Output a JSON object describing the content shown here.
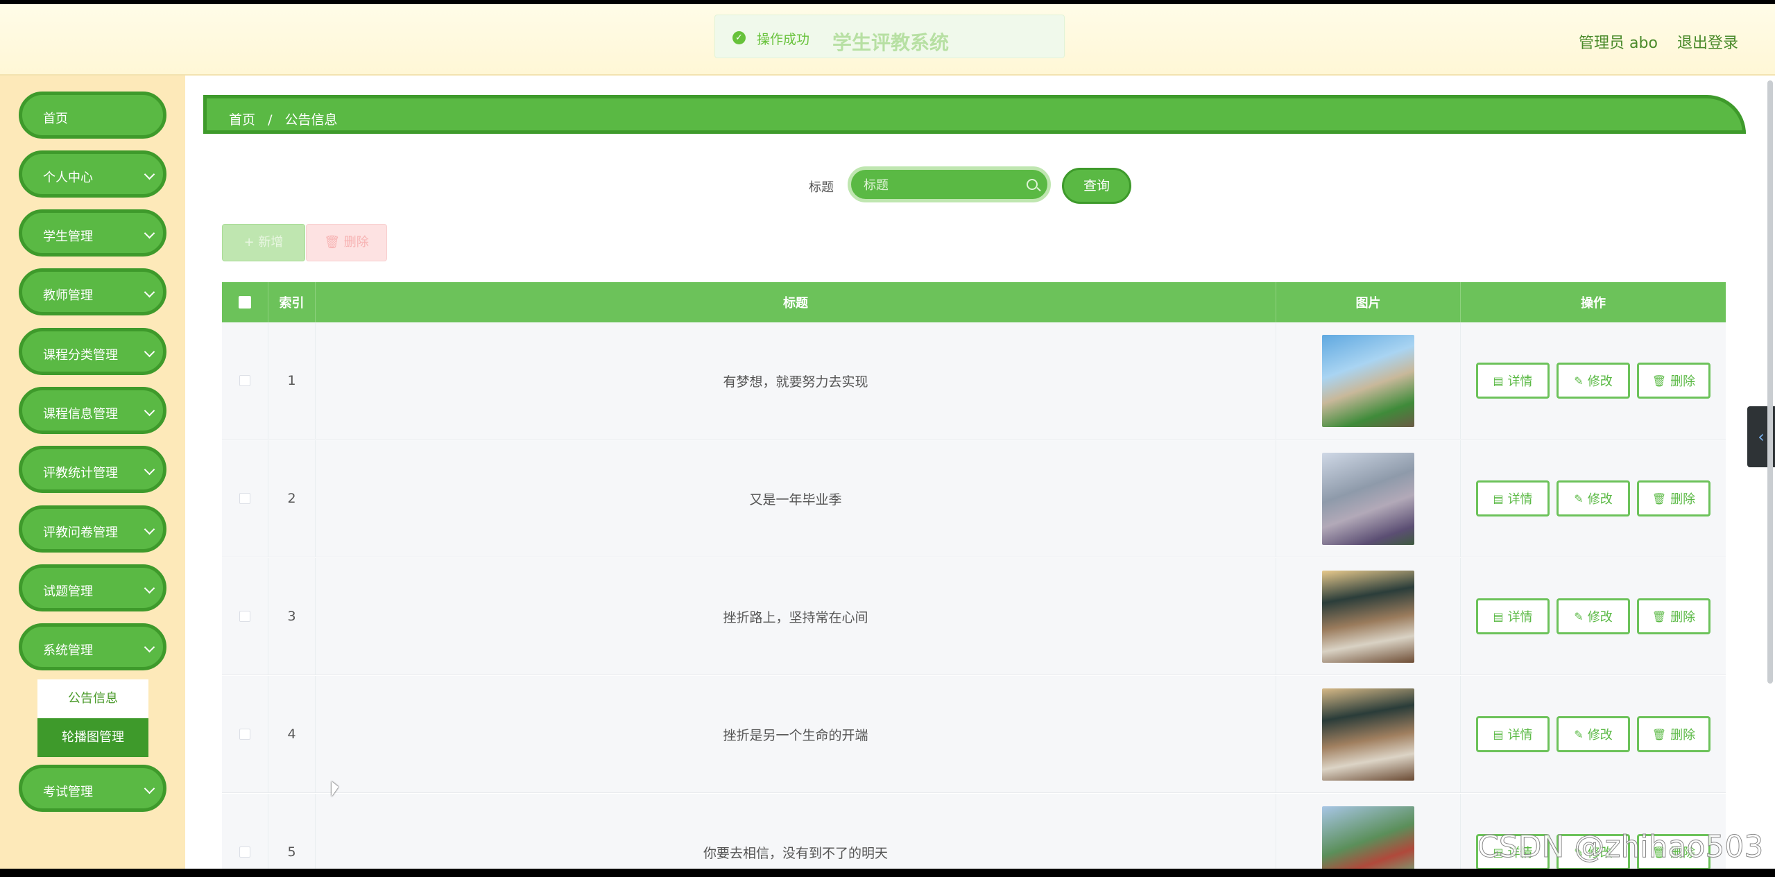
{
  "header": {
    "toast_message": "操作成功",
    "system_title": "学生评教系统",
    "user_label": "管理员 abo",
    "logout_label": "退出登录"
  },
  "sidebar": {
    "items": [
      {
        "label": "首页"
      },
      {
        "label": "个人中心"
      },
      {
        "label": "学生管理"
      },
      {
        "label": "教师管理"
      },
      {
        "label": "课程分类管理"
      },
      {
        "label": "课程信息管理"
      },
      {
        "label": "评教统计管理"
      },
      {
        "label": "评教问卷管理"
      },
      {
        "label": "试题管理"
      },
      {
        "label": "系统管理"
      },
      {
        "label": "考试管理"
      }
    ],
    "submenu": [
      "公告信息",
      "轮播图管理"
    ]
  },
  "breadcrumb": {
    "home": "首页",
    "separator": "/",
    "current": "公告信息"
  },
  "search": {
    "label": "标题",
    "placeholder": "标题",
    "query_label": "查询"
  },
  "toolbar": {
    "add_label": "+ 新增",
    "delete_label": "删除"
  },
  "table": {
    "headers": [
      "索引",
      "标题",
      "图片",
      "操作"
    ],
    "rows": [
      {
        "index": "1",
        "title": "有梦想，就要努力去实现"
      },
      {
        "index": "2",
        "title": "又是一年毕业季"
      },
      {
        "index": "3",
        "title": "挫折路上，坚持常在心间"
      },
      {
        "index": "4",
        "title": "挫折是另一个生命的开端"
      },
      {
        "index": "5",
        "title": "你要去相信，没有到不了的明天"
      }
    ],
    "actions": {
      "detail": "详情",
      "edit": "修改",
      "delete": "删除"
    }
  },
  "watermark": "CSDN @zhihao503",
  "colors": {
    "primary": "#5ab944",
    "primary_dark": "#3e9a2b",
    "sidebar_bg": "#fde9b9",
    "header_bg": "#fff7d6"
  }
}
